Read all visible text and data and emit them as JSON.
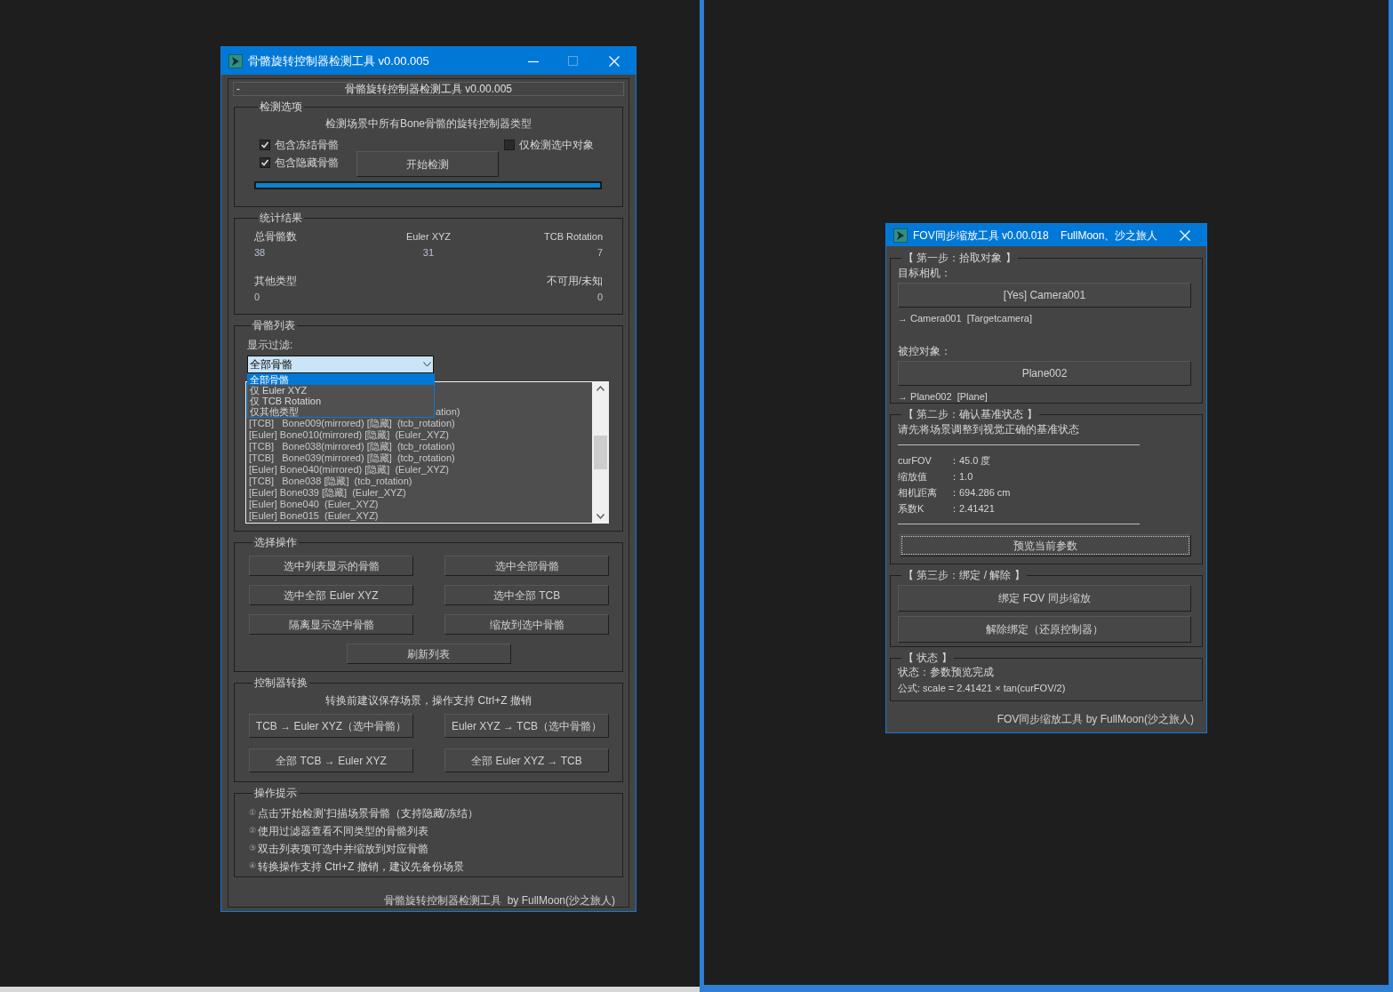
{
  "left_window": {
    "title": "骨骼旋转控制器检测工具 v0.00.005",
    "rollout": {
      "toggle": "-",
      "title": "骨骼旋转控制器检测工具 v0.00.005"
    },
    "detect_options": {
      "label": "检测选项",
      "description": "检测场景中所有Bone骨骼的旋转控制器类型",
      "checkboxes": [
        {
          "label": "包含冻结骨骼",
          "checked": true
        },
        {
          "label": "包含隐藏骨骼",
          "checked": true
        },
        {
          "label": "仅检测选中对象",
          "checked": false
        }
      ],
      "start_button": "开始检测",
      "progress": {
        "level": 1
      }
    },
    "stats": {
      "label": "统计结果",
      "items": [
        {
          "label": "总骨骼数",
          "value": "38"
        },
        {
          "label": "Euler XYZ",
          "value": "31"
        },
        {
          "label": "TCB Rotation",
          "value": "7"
        },
        {
          "label": "其他类型",
          "value": "0"
        },
        {
          "label": "不可用/未知",
          "value": "0"
        }
      ]
    },
    "bone_list": {
      "label": "骨骼列表",
      "filter_label": "显示过滤:",
      "filter_value": "全部骨骼",
      "filter_options": [
        {
          "label": "全部骨骼",
          "selected": true
        },
        {
          "label": "仅 Euler XYZ",
          "selected": false
        },
        {
          "label": "仅 TCB Rotation",
          "selected": false
        },
        {
          "label": "仅其他类型",
          "selected": false
        }
      ],
      "rows": [
        {
          "kind": "cut",
          "text": "ation)"
        },
        {
          "kind": "full",
          "text": "[TCB]   Bone009(mirrored) [隐藏]  (tcb_rotation)"
        },
        {
          "kind": "full",
          "text": "[Euler] Bone010(mirrored) [隐藏]  (Euler_XYZ)"
        },
        {
          "kind": "full",
          "text": "[TCB]   Bone038(mirrored) [隐藏]  (tcb_rotation)"
        },
        {
          "kind": "full",
          "text": "[TCB]   Bone039(mirrored) [隐藏]  (tcb_rotation)"
        },
        {
          "kind": "full",
          "text": "[Euler] Bone040(mirrored) [隐藏]  (Euler_XYZ)"
        },
        {
          "kind": "full",
          "text": "[TCB]   Bone038 [隐藏]  (tcb_rotation)"
        },
        {
          "kind": "full",
          "text": "[Euler] Bone039 [隐藏]  (Euler_XYZ)"
        },
        {
          "kind": "full",
          "text": "[Euler] Bone040  (Euler_XYZ)"
        },
        {
          "kind": "full",
          "text": "[Euler] Bone015  (Euler_XYZ)"
        }
      ]
    },
    "select_ops": {
      "label": "选择操作",
      "buttons": [
        "选中列表显示的骨骼",
        "选中全部骨骼",
        "选中全部 Euler XYZ",
        "选中全部 TCB",
        "隔离显示选中骨骼",
        "缩放到选中骨骼",
        "刷新列表"
      ]
    },
    "convert": {
      "label": "控制器转换",
      "note": "转换前建议保存场景，操作支持 Ctrl+Z 撤销",
      "buttons": [
        "TCB → Euler XYZ（选中骨骼）",
        "Euler XYZ → TCB（选中骨骼）",
        "全部 TCB → Euler XYZ",
        "全部 Euler XYZ → TCB"
      ]
    },
    "tips": {
      "label": "操作提示",
      "items": [
        {
          "marker": "①",
          "text": "点击'开始检测'扫描场景骨骼（支持隐藏/冻结）"
        },
        {
          "marker": "②",
          "text": "使用过滤器查看不同类型的骨骼列表"
        },
        {
          "marker": "③",
          "text": "双击列表项可选中并缩放到对应骨骼"
        },
        {
          "marker": "④",
          "text": "转换操作支持 Ctrl+Z 撤销，建议先备份场景"
        }
      ]
    },
    "footer": "骨骼旋转控制器检测工具  by FullMoon(沙之旅人)"
  },
  "right_window": {
    "title": "FOV同步缩放工具 v0.00.018    FullMoon、沙之旅人",
    "step1": {
      "label": "【 第一步：拾取对象 】",
      "camera_label": "目标相机：",
      "camera_button": "[Yes] Camera001",
      "camera_info": "→ Camera001  [Targetcamera]",
      "target_label": "被控对象：",
      "target_button": "Plane002",
      "target_info": "→ Plane002  [Plane]"
    },
    "step2": {
      "label": "【 第二步：确认基准状态 】",
      "instruction": "请先将场景调整到视觉正确的基准状态",
      "params": [
        {
          "name": "curFOV",
          "value": "：45.0 度"
        },
        {
          "name": "缩放值",
          "value": "：1.0"
        },
        {
          "name": "相机距离",
          "value": "：694.286 cm"
        },
        {
          "name": "系数K",
          "value": "：2.41421"
        }
      ],
      "preview_button": {
        "label": "预览当前参数",
        "focused": true
      }
    },
    "step3": {
      "label": "【 第三步：绑定 / 解除 】",
      "buttons": [
        "绑定 FOV 同步缩放",
        "解除绑定（还原控制器）"
      ]
    },
    "status": {
      "label": "【 状态 】",
      "lines": [
        "状态：参数预览完成",
        "公式: scale = 2.41421 × tan(curFOV/2)"
      ]
    },
    "footer": "FOV同步缩放工具 by FullMoon(沙之旅人)"
  }
}
